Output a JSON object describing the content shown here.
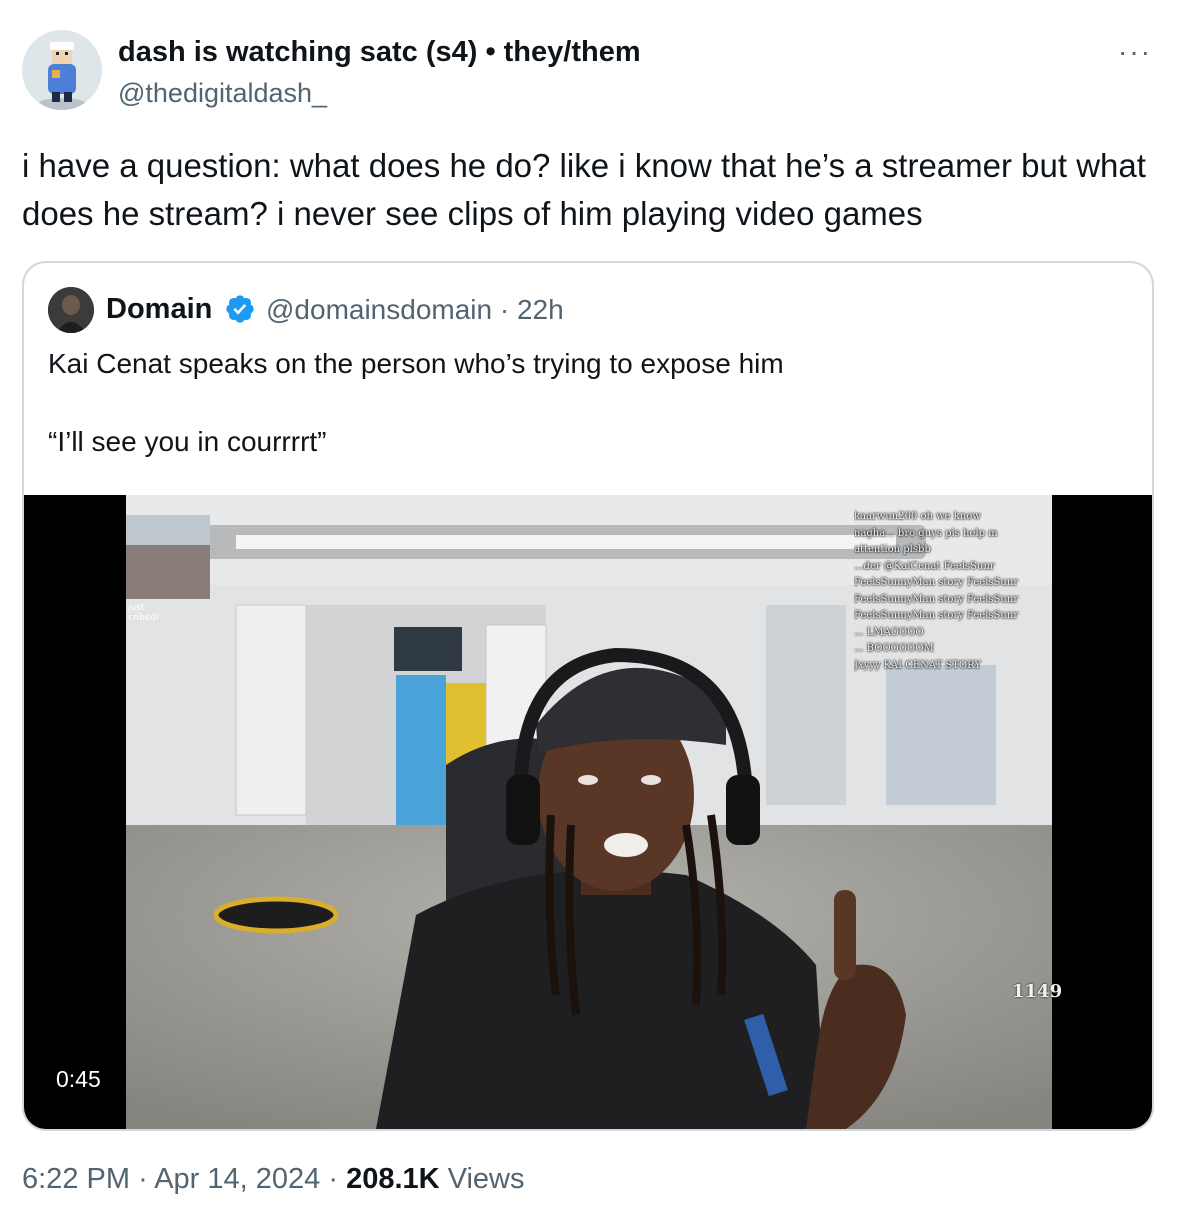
{
  "author": {
    "display_name": "dash is watching satc (s4) • they/them",
    "handle": "@thedigitaldash_"
  },
  "more_label": "···",
  "tweet": {
    "text": "i have a question: what does he do? like i know that he’s a streamer but what does he stream? i never see clips of him playing video games"
  },
  "quoted": {
    "name": "Domain",
    "handle": "@domainsdomain",
    "separator": "·",
    "age": "22h",
    "text": "Kai Cenat speaks on the person who’s trying to expose him",
    "quote_line": "“I’ll see you in courrrrt”",
    "video": {
      "duration": "0:45",
      "overlay": {
        "chat": [
          "kaarwun200  oh we know",
          "nagha...  bro guys pls help m",
          "attention plsbb",
          "...der  @KaiCenat FeelsSunr",
          "FeelsSunnyMan story FeelsSunr",
          "FeelsSunnyMan story FeelsSunr",
          "FeelsSunnyMan story FeelsSunr",
          "...  LMAOOOO",
          "...  BOOOOOOM",
          "Jxyyy  KAI CENAT STORY"
        ],
        "counter": "1149",
        "cam_caption": "just\ncribed!"
      }
    }
  },
  "footer": {
    "time": "6:22 PM",
    "dot1": "·",
    "date": "Apr 14, 2024",
    "dot2": "·",
    "views_count": "208.1K",
    "views_label": "Views"
  },
  "colors": {
    "text": "#0f1419",
    "secondary": "#536471",
    "border": "#cfd9de",
    "verified": "#1d9bf0"
  }
}
